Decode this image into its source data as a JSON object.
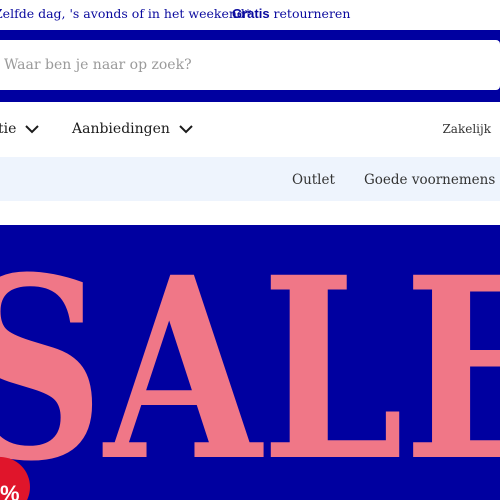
{
  "topbar": {
    "delivery_text": "Zelfde dag, 's avonds of in het weekend*",
    "returns_bold": "Gratis",
    "returns_text": " retourneren"
  },
  "search": {
    "placeholder": "Waar ben je naar op zoek?"
  },
  "nav": {
    "items": [
      {
        "label": "tie",
        "icon": "chevron-down-icon"
      },
      {
        "label": "Aanbiedingen",
        "icon": "chevron-down-icon"
      }
    ],
    "business_label": "Zakelijk"
  },
  "subnav": {
    "links": [
      {
        "label": "Outlet"
      },
      {
        "label": "Goede voornemens"
      }
    ]
  },
  "hero": {
    "sale_text": "SALE",
    "badge_text": "%",
    "colors": {
      "background": "#0000a0",
      "sale_text": "#f07787",
      "badge": "#e0152b"
    }
  },
  "colors": {
    "brand_blue": "#0000a0",
    "subnav_bg": "#eef4fd"
  }
}
